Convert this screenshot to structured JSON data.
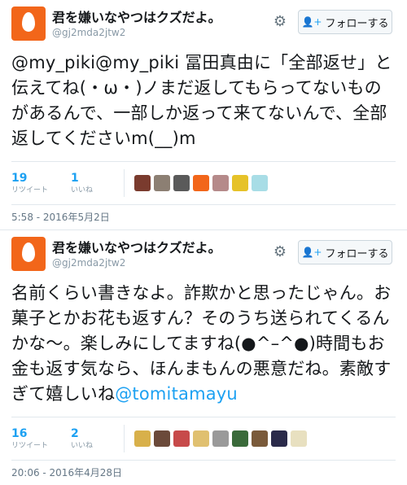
{
  "tweets": [
    {
      "user": {
        "name": "君を嫌いなやつはクズだよ。",
        "handle": "@gj2mda2jtw2"
      },
      "follow_label": "フォローする",
      "text_parts": [
        {
          "text": "@my_piki@my_piki 冨田真由に「全部返せ」と伝えてね(・ω・)ノまだ返してもらってないものがあるんで、一部しか返って来てないんで、全部返してくださいm(__)m",
          "mention": false
        }
      ],
      "retweets": {
        "count": "19",
        "label": "リツイート"
      },
      "likes": {
        "count": "1",
        "label": "いいね"
      },
      "liker_avatars": [
        {
          "color": "#7a3b2e",
          "icon": "user-avatar-icon"
        },
        {
          "color": "#8c7f73",
          "icon": "user-avatar-icon"
        },
        {
          "color": "#5a5a5a",
          "icon": "user-avatar-icon"
        },
        {
          "color": "#f2661a",
          "icon": "egg-avatar-icon"
        },
        {
          "color": "#b58a8a",
          "icon": "user-avatar-icon"
        },
        {
          "color": "#e6c229",
          "icon": "user-avatar-icon"
        },
        {
          "color": "#a8dde6",
          "icon": "user-avatar-icon"
        }
      ],
      "timestamp": "5:58 - 2016年5月2日"
    },
    {
      "user": {
        "name": "君を嫌いなやつはクズだよ。",
        "handle": "@gj2mda2jtw2"
      },
      "follow_label": "フォローする",
      "text_parts": [
        {
          "text": "名前くらい書きなよ。詐欺かと思ったじゃん。お菓子とかお花も返すん？そのうち送られてくるんかな〜。楽しみにしてますね(●^–^●)時間もお金も返す気なら、ほんまもんの悪意だね。素敵すぎて嬉しいね",
          "mention": false
        },
        {
          "text": "@tomitamayu",
          "mention": true
        }
      ],
      "retweets": {
        "count": "16",
        "label": "リツイート"
      },
      "likes": {
        "count": "2",
        "label": "いいね"
      },
      "liker_avatars": [
        {
          "color": "#d8b04a",
          "icon": "user-avatar-icon"
        },
        {
          "color": "#6b4a3a",
          "icon": "user-avatar-icon"
        },
        {
          "color": "#c74a4a",
          "icon": "user-avatar-icon"
        },
        {
          "color": "#e0c070",
          "icon": "user-avatar-icon"
        },
        {
          "color": "#9a9a9a",
          "icon": "user-avatar-icon"
        },
        {
          "color": "#3a6a3a",
          "icon": "user-avatar-icon"
        },
        {
          "color": "#7a5a3a",
          "icon": "user-avatar-icon"
        },
        {
          "color": "#2a2a4a",
          "icon": "user-avatar-icon"
        },
        {
          "color": "#e8e0c0",
          "icon": "user-avatar-icon"
        }
      ],
      "timestamp": "20:06 - 2016年4月28日"
    }
  ],
  "colors": {
    "accent": "#1da1f2",
    "avatar": "#f2661a",
    "muted": "#8899a6"
  },
  "icons": {
    "settings": "gear-icon",
    "follow": "add-user-icon"
  }
}
